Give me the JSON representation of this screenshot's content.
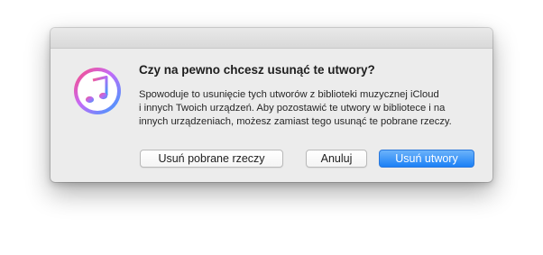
{
  "dialog": {
    "icon": "itunes-music-note-icon",
    "title": "Czy na pewno chcesz usunąć te utwory?",
    "message_lines": [
      "Spowoduje to usunięcie tych utworów z biblioteki muzycznej iCloud",
      "i innych Twoich urządzeń. Aby pozostawić te utwory w bibliotece i na",
      "innych urządzeniach, możesz zamiast tego usunąć te pobrane rzeczy."
    ],
    "buttons": {
      "remove_downloads": "Usuń pobrane rzeczy",
      "cancel": "Anuluj",
      "remove_songs": "Usuń utwory"
    }
  },
  "colors": {
    "dialog_background": "#ececec",
    "primary_button": "#1b80f6",
    "icon_ring_start": "#fd4a79",
    "icon_ring_end": "#2fa0ff"
  }
}
